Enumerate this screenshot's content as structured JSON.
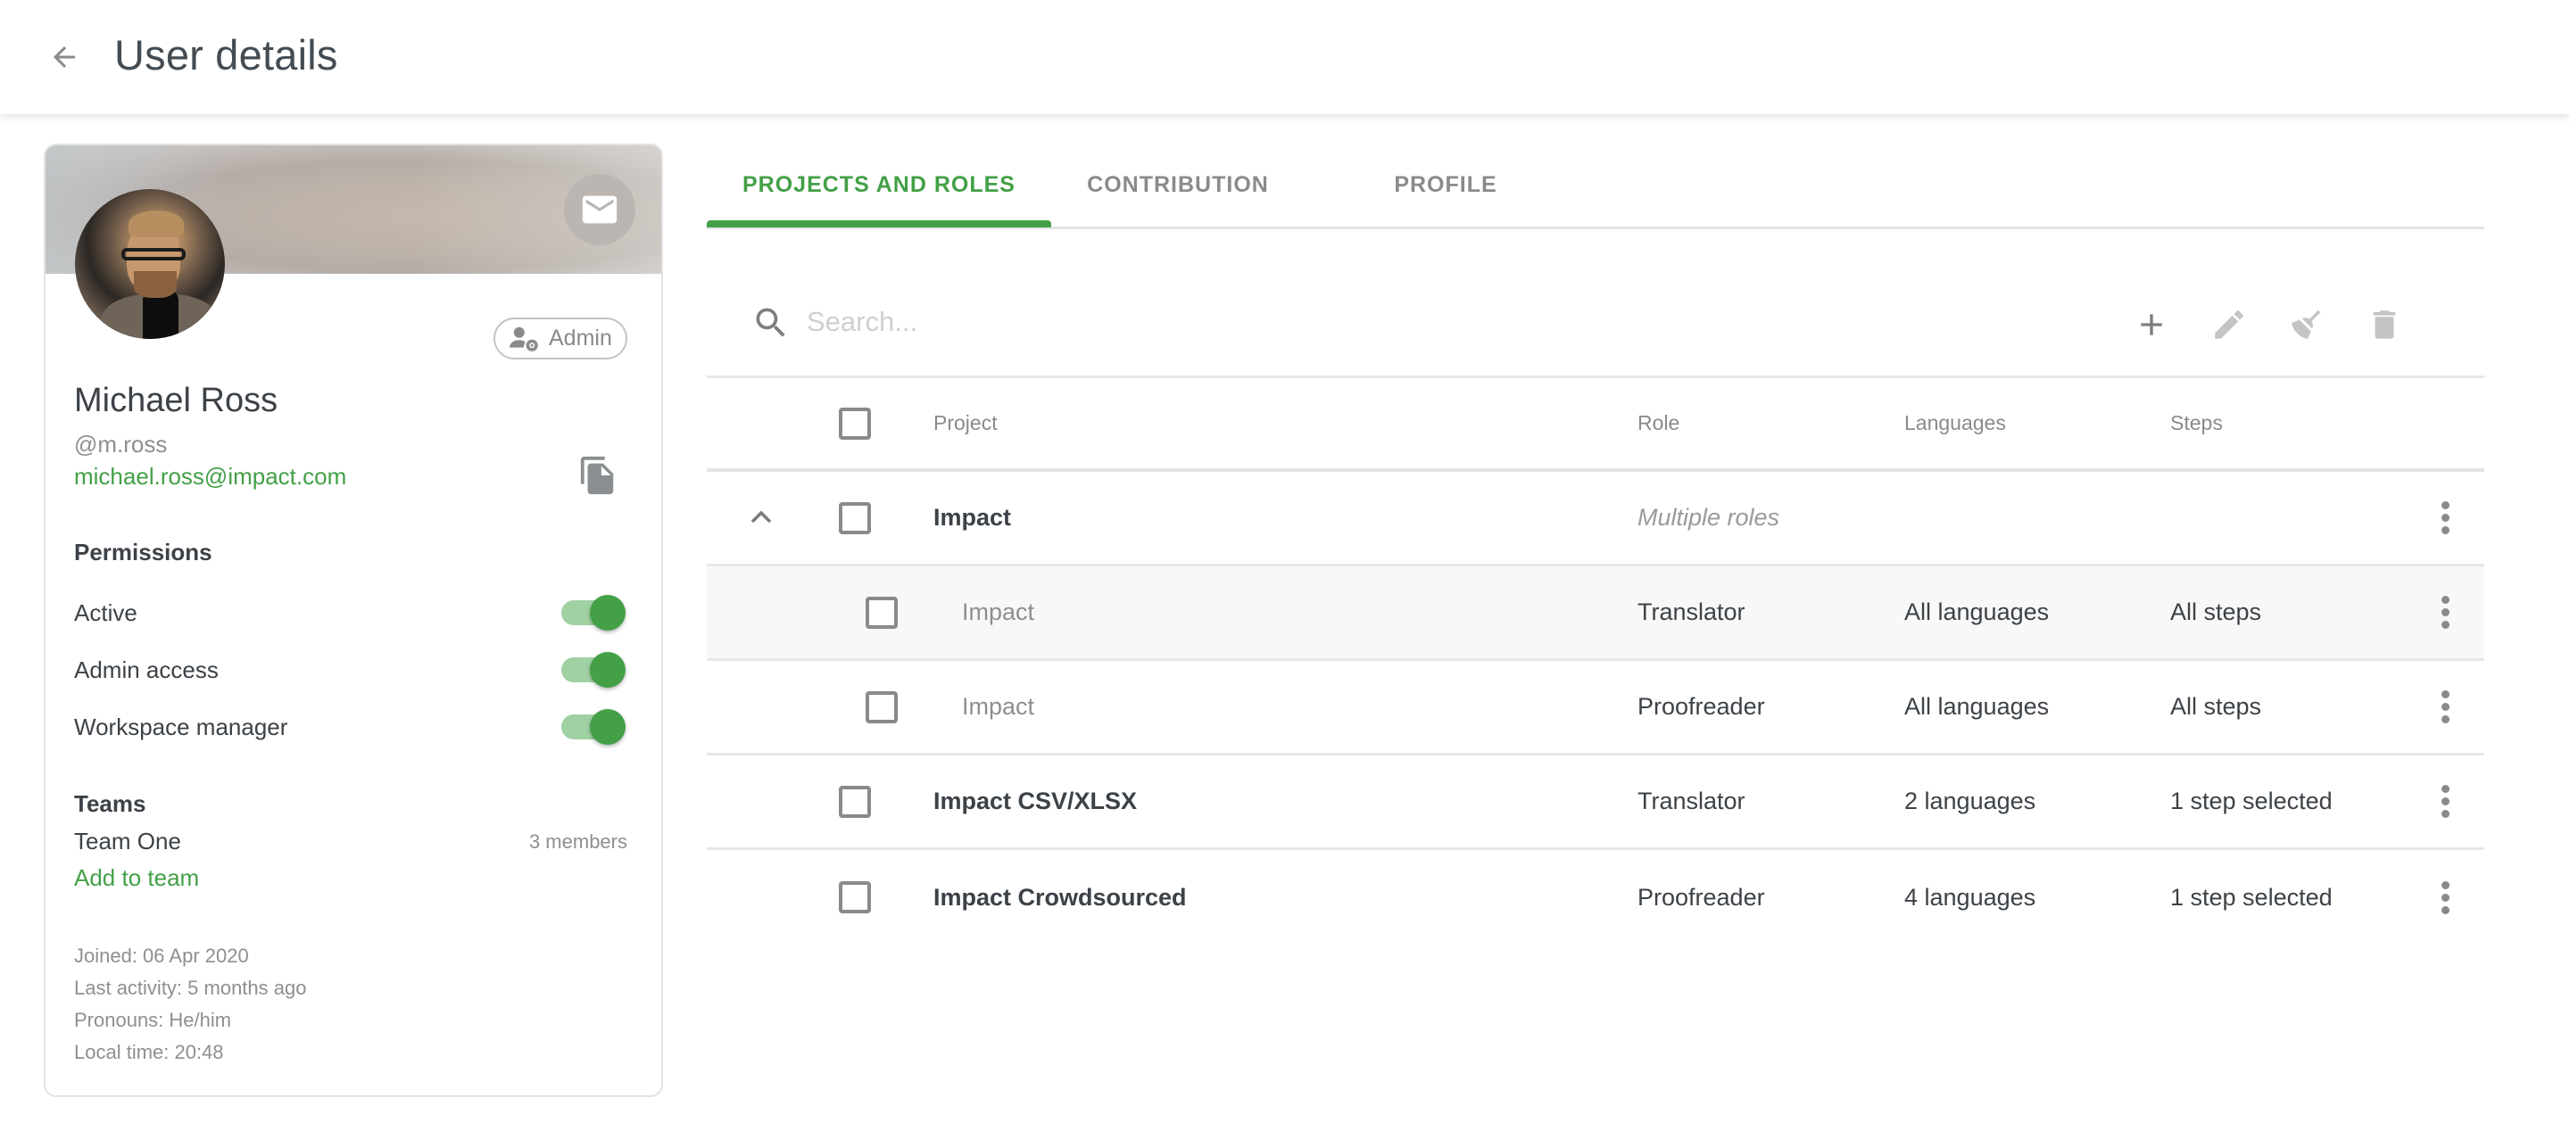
{
  "header": {
    "title": "User details",
    "back_icon": "arrow-left-icon"
  },
  "profile": {
    "name": "Michael Ross",
    "handle": "@m.ross",
    "email": "michael.ross@impact.com",
    "role_chip": "Admin",
    "role_chip_icon": "user-cog-icon",
    "email_button_icon": "mail-icon",
    "copy_icon": "copy-icon",
    "permissions_title": "Permissions",
    "permissions": [
      {
        "label": "Active",
        "enabled": true
      },
      {
        "label": "Admin access",
        "enabled": true
      },
      {
        "label": "Workspace manager",
        "enabled": true
      }
    ],
    "teams_title": "Teams",
    "teams": [
      {
        "name": "Team One",
        "members": "3 members"
      }
    ],
    "add_to_team": "Add to team",
    "meta": {
      "joined": "Joined: 06 Apr 2020",
      "last_activity": "Last activity: 5 months ago",
      "pronouns": "Pronouns: He/him",
      "local_time": "Local time: 20:48"
    }
  },
  "tabs": [
    {
      "label": "PROJECTS AND ROLES",
      "active": true
    },
    {
      "label": "CONTRIBUTION",
      "active": false
    },
    {
      "label": "PROFILE",
      "active": false
    }
  ],
  "toolbar": {
    "search_placeholder": "Search...",
    "search_value": "",
    "actions": [
      {
        "name": "add",
        "icon": "plus-icon",
        "enabled": true
      },
      {
        "name": "edit",
        "icon": "pencil-icon",
        "enabled": false
      },
      {
        "name": "clear",
        "icon": "broom-icon",
        "enabled": false
      },
      {
        "name": "delete",
        "icon": "trash-icon",
        "enabled": false
      }
    ]
  },
  "table": {
    "columns": [
      "Project",
      "Role",
      "Languages",
      "Steps"
    ],
    "rows": [
      {
        "project": "Impact",
        "role": "Multiple roles",
        "languages": "",
        "steps": "",
        "type": "group",
        "expanded": true
      },
      {
        "project": "Impact",
        "role": "Translator",
        "languages": "All languages",
        "steps": "All steps",
        "type": "child"
      },
      {
        "project": "Impact",
        "role": "Proofreader",
        "languages": "All languages",
        "steps": "All steps",
        "type": "child"
      },
      {
        "project": "Impact CSV/XLSX",
        "role": "Translator",
        "languages": "2 languages",
        "steps": "1 step selected",
        "type": "single"
      },
      {
        "project": "Impact Crowdsourced",
        "role": "Proofreader",
        "languages": "4 languages",
        "steps": "1 step selected",
        "type": "single"
      }
    ]
  },
  "colors": {
    "accent": "#43a047",
    "accent_light": "#a0d1a3",
    "text": "#3c4247",
    "muted": "#8f8f8f"
  }
}
